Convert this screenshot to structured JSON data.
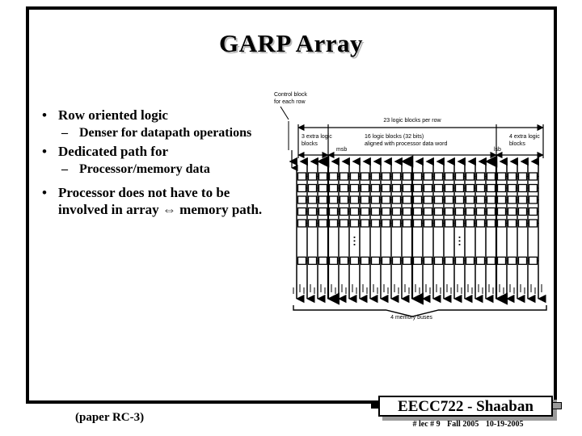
{
  "slide": {
    "title": "GARP Array",
    "bullets": [
      {
        "level": 1,
        "marker": "•",
        "text": "Row oriented logic"
      },
      {
        "level": 2,
        "marker": "–",
        "text": "Denser for datapath operations"
      },
      {
        "level": 1,
        "marker": "•",
        "text": "Dedicated path for"
      },
      {
        "level": 2,
        "marker": "–",
        "text": "Processor/memory data"
      },
      {
        "level": 1,
        "marker": "•",
        "text": "Processor does not have to be involved in array ⇔ memory path."
      }
    ],
    "paper_ref": "(paper RC-3)"
  },
  "diagram": {
    "name": "garp-array-diagram",
    "labels": {
      "control_block": "Control block\nfor each row",
      "blocks_per_row": "23 logic blocks per row",
      "extra_left": "3 extra logic\nblocks",
      "msb": "msb",
      "center": "16 logic blocks (32 bits)\naligned with processor data word",
      "lsb": "lsb",
      "extra_right": "4 extra logic\nblocks",
      "memory_buses": "4 memory buses"
    },
    "columns": 23,
    "rows": 6,
    "ellipsis": "⋮"
  },
  "footer": {
    "badge": "EECC722 - Shaaban",
    "lecture": "# lec # 9",
    "term": "Fall 2005",
    "date": "10-19-2005"
  },
  "colors": {
    "ink": "#000000",
    "paper": "#ffffff",
    "shadow": "#9a9a9a"
  }
}
